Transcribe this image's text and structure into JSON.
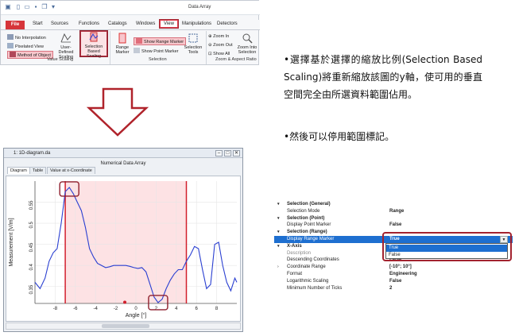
{
  "ribbon": {
    "title": "Data Array",
    "tabs": [
      "File",
      "Start",
      "Sources",
      "Functions",
      "Catalogs",
      "Windows",
      "View",
      "Manipulations",
      "Detectors"
    ],
    "value_scaling": {
      "group_label": "Value Scaling",
      "items": [
        "No Interpolation",
        "Pixelated View",
        "Method of Object"
      ],
      "user_defined": "User-Defined Scaling",
      "selection_based": "Selection Based Scaling"
    },
    "selection": {
      "group_label": "Selection",
      "range_marker": "Range Marker",
      "show_range_marker": "Show Range Marker",
      "show_point_marker": "Show Point Marker",
      "selection_tools": "Selection Tools"
    },
    "zoom": {
      "group_label": "Zoom & Aspect Ratio",
      "zoom_in": "Zoom In",
      "zoom_out": "Zoom Out",
      "show_all": "Show All",
      "zoom_into_selection": "Zoom Into Selection"
    }
  },
  "description": {
    "para1": "•選擇基於選擇的縮放比例(Selection Based Scaling)將重新縮放該圖的y軸，使可用的垂直空間完全由所選資料範圍佔用。",
    "para2": "•然後可以停用範圍標記。"
  },
  "diagram": {
    "window_title": "1: 1D-diagram.da",
    "inner_title": "Numerical Data Array",
    "tabs": [
      "Diagram",
      "Table",
      "Value at x-Coordinate"
    ],
    "chart_data": {
      "type": "line",
      "xlabel": "Angle [°]",
      "ylabel": "Measurement [V/m]",
      "xlim": [
        -10,
        10
      ],
      "ylim": [
        0.31,
        0.6
      ],
      "x_ticks": [
        -8,
        -6,
        -4,
        -2,
        0,
        2,
        4,
        6,
        8
      ],
      "y_ticks": [
        0.35,
        0.4,
        0.45,
        0.5,
        0.55
      ],
      "selected_range": [
        -7,
        5
      ],
      "series": [
        {
          "color": "#2a3fd1",
          "x": [
            -10,
            -9.5,
            -9,
            -8.6,
            -8.2,
            -7.8,
            -7.4,
            -7.0,
            -6.6,
            -6.2,
            -5.8,
            -5.4,
            -5.0,
            -4.6,
            -4.2,
            -3.8,
            -3.4,
            -3.0,
            -2.6,
            -2.2,
            -1.8,
            -1.4,
            -1.0,
            -0.6,
            -0.2,
            0.2,
            0.6,
            1.0,
            1.4,
            1.8,
            2.2,
            2.6,
            3.0,
            3.4,
            3.8,
            4.2,
            4.6,
            5.0,
            5.4,
            5.8,
            6.2,
            6.6,
            7.0,
            7.4,
            7.8,
            8.2,
            8.6,
            9.0,
            9.4,
            9.8,
            10
          ],
          "y": [
            0.36,
            0.345,
            0.37,
            0.41,
            0.43,
            0.44,
            0.5,
            0.575,
            0.585,
            0.57,
            0.55,
            0.53,
            0.49,
            0.44,
            0.42,
            0.405,
            0.4,
            0.395,
            0.397,
            0.4,
            0.4,
            0.4,
            0.4,
            0.398,
            0.395,
            0.393,
            0.395,
            0.385,
            0.355,
            0.325,
            0.312,
            0.32,
            0.345,
            0.365,
            0.38,
            0.39,
            0.39,
            0.41,
            0.425,
            0.445,
            0.44,
            0.39,
            0.345,
            0.355,
            0.45,
            0.455,
            0.4,
            0.36,
            0.34,
            0.37,
            0.36
          ]
        }
      ]
    }
  },
  "properties": {
    "rows": [
      {
        "name": "Selection (General)",
        "cat": true
      },
      {
        "name": "Selection Mode",
        "value": "Range"
      },
      {
        "name": "Selection (Point)",
        "cat": true
      },
      {
        "name": "Display Point Marker",
        "value": "False"
      },
      {
        "name": "Selection (Range)",
        "cat": true
      },
      {
        "name": "Display Range Marker",
        "value": "True",
        "selected": true
      },
      {
        "name": "X-Axis",
        "cat": true
      },
      {
        "name": "Description",
        "value": "",
        "gray": true
      },
      {
        "name": "Descending Coordinates",
        "value": "False"
      },
      {
        "name": "Coordinate Range",
        "value": "[-10°; 10°]",
        "collapsed": true
      },
      {
        "name": "Format",
        "value": "Engineering"
      },
      {
        "name": "Logarithmic Scaling",
        "value": "False"
      },
      {
        "name": "Minimum Number of Ticks",
        "value": "2"
      }
    ],
    "dropdown_options": [
      "True",
      "False"
    ]
  }
}
